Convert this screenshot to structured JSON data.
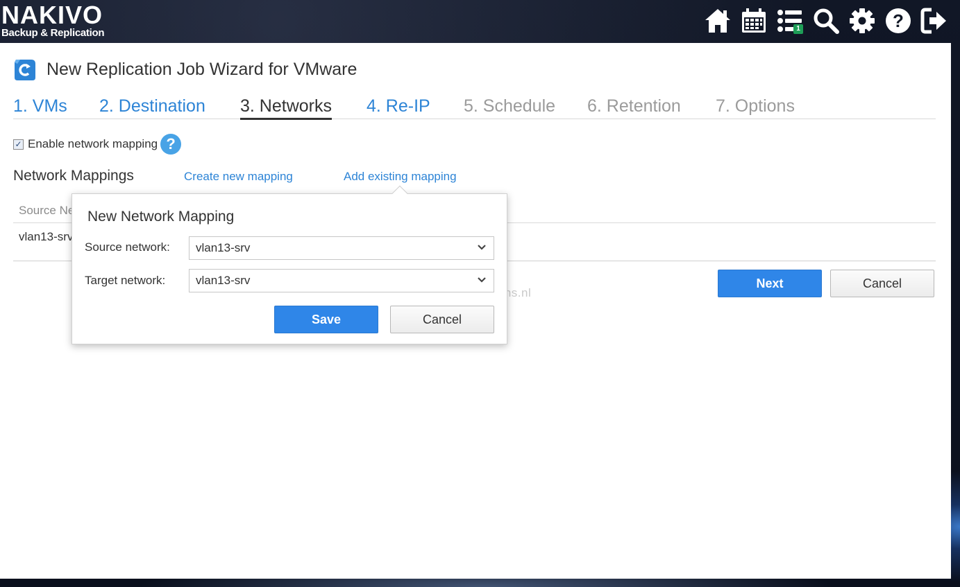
{
  "app": {
    "logo_main": "NAKIVO",
    "logo_sub": "Backup & Replication"
  },
  "topbar": {
    "icons": [
      "home-icon",
      "calendar-icon",
      "job-list-icon",
      "search-icon",
      "gear-icon",
      "help-icon",
      "logout-icon"
    ],
    "job_list_badge": "1"
  },
  "wizard": {
    "title": "New Replication Job Wizard for VMware",
    "steps": [
      {
        "label": "1. VMs",
        "state": "done"
      },
      {
        "label": "2. Destination",
        "state": "done"
      },
      {
        "label": "3. Networks",
        "state": "active"
      },
      {
        "label": "4. Re-IP",
        "state": "done"
      },
      {
        "label": "5. Schedule",
        "state": "todo"
      },
      {
        "label": "6. Retention",
        "state": "todo"
      },
      {
        "label": "7. Options",
        "state": "todo"
      }
    ],
    "enable_mapping_label": "Enable network mapping",
    "enable_mapping_checked": true,
    "help_glyph": "?",
    "network_mappings_title": "Network Mappings",
    "create_new_mapping": "Create new mapping",
    "add_existing_mapping": "Add existing mapping",
    "table": {
      "header_source": "Source Ne",
      "row_source": "vlan13-srv"
    },
    "next_label": "Next",
    "cancel_label": "Cancel"
  },
  "popup": {
    "title": "New Network Mapping",
    "source_label": "Source network:",
    "source_value": "vlan13-srv",
    "target_label": "Target network:",
    "target_value": "vlan13-srv",
    "save_label": "Save",
    "cancel_label": "Cancel"
  },
  "watermark": "www.ivobeerens.nl",
  "colors": {
    "accent": "#2f86e8",
    "link": "#2d84d6",
    "badge": "#1e9e57"
  }
}
